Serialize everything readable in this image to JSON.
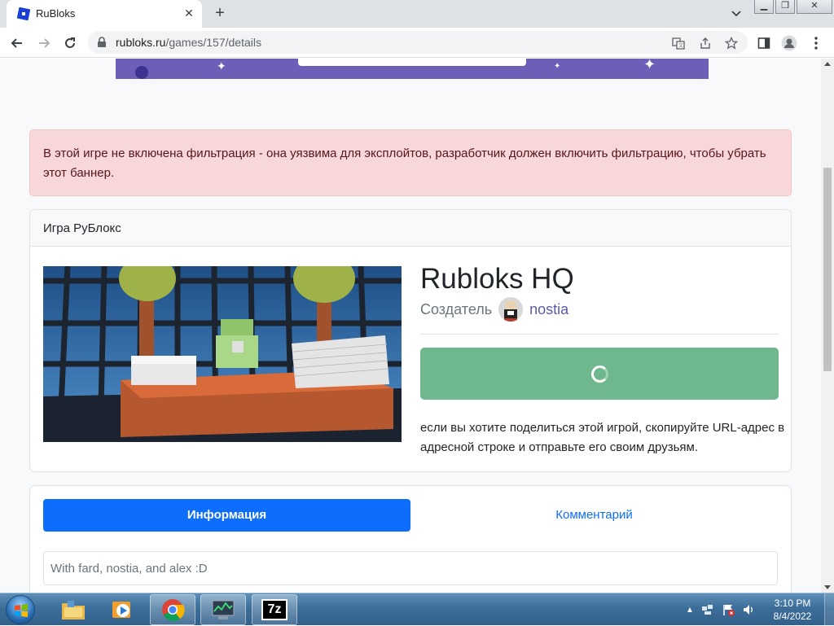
{
  "browser": {
    "tab_title": "RuBloks",
    "url_host": "rubloks.ru",
    "url_path": "/games/157/details"
  },
  "page": {
    "alert_text": "В этой игре не включена фильтрация - она уязвима для эксплойтов, разработчик должен включить фильтрацию, чтобы убрать этот баннер.",
    "card_header": "Игра РуБлокс",
    "game_title": "Rubloks HQ",
    "creator_label": "Создатель",
    "creator_name": "nostia",
    "share_text": "если вы хотите поделиться этой игрой, скопируйте URL-адрес в адресной строке и отправьте его своим друзьям.",
    "tabs": [
      {
        "label": "Информация",
        "active": true
      },
      {
        "label": "Комментарий",
        "active": false
      }
    ],
    "description": "With fard, nostia, and alex :D"
  },
  "taskbar": {
    "apps": [
      "windows-explorer",
      "media-player",
      "chrome",
      "task-manager",
      "7-zip"
    ],
    "seven_zip_label": "7z",
    "clock_time": "3:10 PM",
    "clock_date": "8/4/2022"
  },
  "colors": {
    "alert_bg": "#f8d7da",
    "play_button": "#6fb88e",
    "primary": "#0d6efd",
    "creator_link": "#5b5aa6",
    "ad_banner": "#6b5fb8"
  }
}
